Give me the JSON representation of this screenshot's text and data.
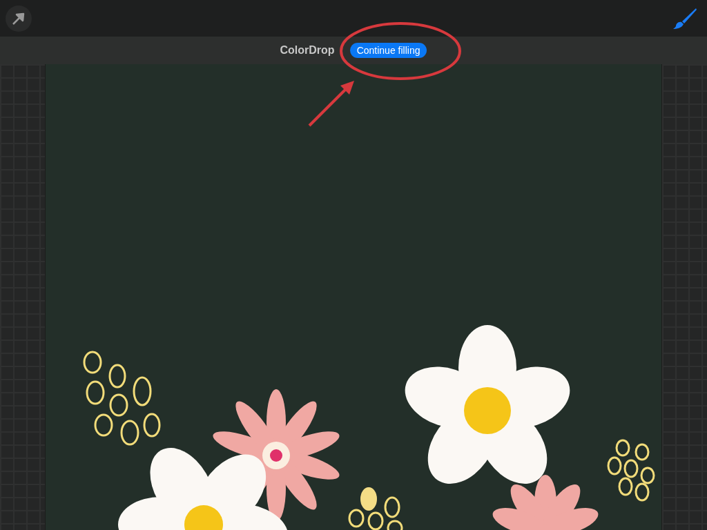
{
  "notice": {
    "title": "ColorDrop",
    "button": "Continue filling"
  }
}
